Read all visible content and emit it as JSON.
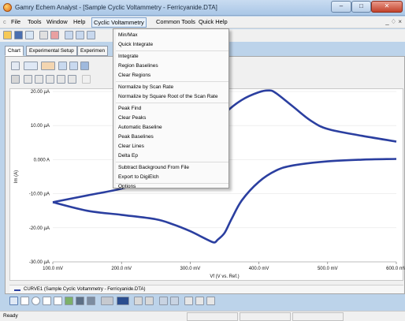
{
  "window": {
    "title": "Gamry Echem Analyst - [Sample Cyclic Voltammetry - Ferricyanide.DTA]",
    "minimize": "–",
    "maximize": "□",
    "close": "✕"
  },
  "menubar": {
    "items": [
      "File",
      "Tools",
      "Window",
      "Help",
      "Cyclic Voltammetry",
      "Common Tools",
      "Quick Help"
    ],
    "right_controls": "_ ♢ ×"
  },
  "tabs": [
    "Chart",
    "Experimental Setup",
    "Experimen"
  ],
  "dropdown": {
    "items": [
      "Min/Max",
      "Quick Integrate",
      "Integrate",
      "Region Baselines",
      "Clear Regions",
      "Normalize by Scan Rate",
      "Normalize by Square Root of the Scan Rate",
      "Peak Find",
      "Clear Peaks",
      "Automatic Baseline",
      "Peak Baselines",
      "Clear Lines",
      "Delta Ep",
      "Subtract Background From File",
      "Export to DigiElch",
      "Options"
    ]
  },
  "legend": {
    "label": "CURVE1 (Sample Cyclic Voltammetry - Ferricyanide.DTA)",
    "color": "#2b3fa0"
  },
  "status": {
    "text": "Ready"
  },
  "chart_data": {
    "type": "line",
    "xlabel": "Vf (V vs. Ref.)",
    "ylabel": "Im (A)",
    "xlim": [
      100,
      600
    ],
    "ylim": [
      -30,
      20
    ],
    "x_ticks": [
      "100.0 mV",
      "200.0 mV",
      "300.0 mV",
      "400.0 mV",
      "500.0 mV",
      "600.0 mV"
    ],
    "y_ticks": [
      "20.00 µA",
      "10.00 µA",
      "0.000 A",
      "-10.00 µA",
      "-20.00 µA",
      "-30.00 µA"
    ],
    "series": [
      {
        "name": "CURVE1",
        "color": "#2b3fa0",
        "forward": {
          "x": [
            100,
            150,
            200,
            250,
            275,
            300,
            325,
            350,
            375,
            400,
            415,
            425,
            450,
            475,
            500,
            550,
            600
          ],
          "y": [
            -12.5,
            -10.5,
            -8.5,
            -5.5,
            -2.5,
            2,
            7.5,
            13.5,
            17.5,
            19.8,
            20.3,
            19.5,
            15.5,
            11.5,
            9.0,
            7.0,
            5.3
          ]
        },
        "reverse": {
          "x": [
            600,
            550,
            500,
            450,
            425,
            400,
            375,
            360,
            350,
            340,
            335,
            325,
            300,
            275,
            250,
            200,
            150,
            100
          ],
          "y": [
            0.2,
            0.0,
            -0.5,
            -1.7,
            -3.2,
            -6.5,
            -12.0,
            -17.5,
            -21.5,
            -23.5,
            -24.3,
            -23.5,
            -21.0,
            -19.0,
            -17.5,
            -16.2,
            -15.0,
            -12.5
          ]
        }
      }
    ]
  }
}
